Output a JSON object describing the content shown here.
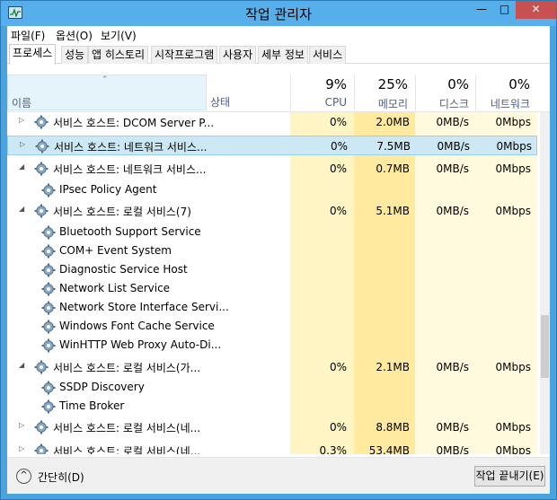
{
  "window": {
    "title": "작업 관리자",
    "minimize": "—",
    "maximize": "□",
    "close": "✕"
  },
  "menu": [
    "파일(F)",
    "옵션(O)",
    "보기(V)"
  ],
  "tabs": [
    "프로세스",
    "성능",
    "앱 히스토리",
    "시작프로그램",
    "사용자",
    "세부 정보",
    "서비스"
  ],
  "active_tab": "프로세스",
  "header": {
    "name": "이름",
    "status": "상태",
    "cpu_pct": "9%",
    "cpu": "CPU",
    "mem_pct": "25%",
    "mem": "메모리",
    "disk_pct": "0%",
    "disk": "디스크",
    "net_pct": "0%",
    "net": "네트워크"
  },
  "rows": [
    {
      "type": "group",
      "expanded": false,
      "name": "서비스 호스트: DCOM Server P...",
      "cpu": "0%",
      "mem": "2.0MB",
      "disk": "0MB/s",
      "net": "0Mbps"
    },
    {
      "type": "group",
      "expanded": false,
      "selected": true,
      "name": "서비스 호스트: 네트워크 서비스...",
      "cpu": "0%",
      "mem": "7.5MB",
      "disk": "0MB/s",
      "net": "0Mbps"
    },
    {
      "type": "group",
      "expanded": true,
      "name": "서비스 호스트: 네트워크 서비스...",
      "cpu": "0%",
      "mem": "0.7MB",
      "disk": "0MB/s",
      "net": "0Mbps"
    },
    {
      "type": "child",
      "name": "IPsec Policy Agent"
    },
    {
      "type": "group",
      "expanded": true,
      "name": "서비스 호스트: 로컬 서비스(7)",
      "cpu": "0%",
      "mem": "5.1MB",
      "disk": "0MB/s",
      "net": "0Mbps"
    },
    {
      "type": "child",
      "name": "Bluetooth Support Service"
    },
    {
      "type": "child",
      "name": "COM+ Event System"
    },
    {
      "type": "child",
      "name": "Diagnostic Service Host"
    },
    {
      "type": "child",
      "name": "Network List Service"
    },
    {
      "type": "child",
      "name": "Network Store Interface Servi..."
    },
    {
      "type": "child",
      "name": "Windows Font Cache Service"
    },
    {
      "type": "child",
      "name": "WinHTTP Web Proxy Auto-Di..."
    },
    {
      "type": "group",
      "expanded": true,
      "name": "서비스 호스트: 로컬 서비스(가...",
      "cpu": "0%",
      "mem": "2.1MB",
      "disk": "0MB/s",
      "net": "0Mbps"
    },
    {
      "type": "child",
      "name": "SSDP Discovery"
    },
    {
      "type": "child",
      "name": "Time Broker"
    },
    {
      "type": "group",
      "expanded": false,
      "name": "서비스 호스트: 로컬 서비스(네...",
      "cpu": "0%",
      "mem": "8.8MB",
      "disk": "0MB/s",
      "net": "0Mbps"
    },
    {
      "type": "group",
      "expanded": false,
      "name": "서비스 호스트: 로컬 서비스(네...",
      "cpu": "0.3%",
      "mem": "53.4MB",
      "disk": "0MB/s",
      "net": "0Mbps"
    }
  ],
  "footer": {
    "collapse_label": "간단히(D)",
    "end_task": "작업 끝내기(E)"
  },
  "colors": {
    "title_bar": "#56aeea",
    "selected_row": "#cce8f4",
    "cpu_col": "#fff4c4",
    "mem_col": "#ffeaa0",
    "light_col": "#fff9dd"
  }
}
